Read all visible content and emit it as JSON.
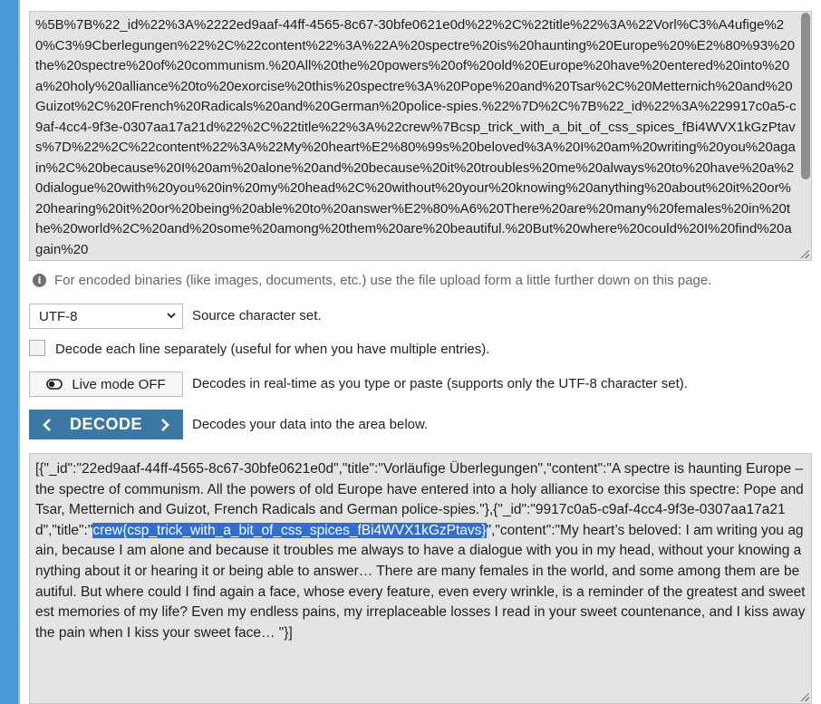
{
  "encoded_input": {
    "value": "%5B%7B%22_id%22%3A%2222ed9aaf-44ff-4565-8c67-30bfe0621e0d%22%2C%22title%22%3A%22Vorl%C3%A4ufige%20%C3%9Cberlegungen%22%2C%22content%22%3A%22A%20spectre%20is%20haunting%20Europe%20%E2%80%93%20the%20spectre%20of%20communism.%20All%20the%20powers%20of%20old%20Europe%20have%20entered%20into%20a%20holy%20alliance%20to%20exorcise%20this%20spectre%3A%20Pope%20and%20Tsar%2C%20Metternich%20and%20Guizot%2C%20French%20Radicals%20and%20German%20police-spies.%22%7D%2C%7B%22_id%22%3A%229917c0a5-c9af-4cc4-9f3e-0307aa17a21d%22%2C%22title%22%3A%22crew%7Bcsp_trick_with_a_bit_of_css_spices_fBi4WVX1kGzPtavs%7D%22%2C%22content%22%3A%22My%20heart%E2%80%99s%20beloved%3A%20I%20am%20writing%20you%20again%2C%20because%20I%20am%20alone%20and%20because%20it%20troubles%20me%20always%20to%20have%20a%20dialogue%20with%20you%20in%20my%20head%2C%20without%20your%20knowing%20anything%20about%20it%20or%20hearing%20it%20or%20being%20able%20to%20answer%E2%80%A6%20There%20are%20many%20females%20in%20the%20world%2C%20and%20some%20among%20them%20are%20beautiful.%20But%20where%20could%20I%20find%20again%20"
  },
  "info_text": "For encoded binaries (like images, documents, etc.) use the file upload form a little further down on this page.",
  "charset": {
    "selected": "UTF-8",
    "label": "Source character set."
  },
  "decode_each_line": {
    "label": "Decode each line separately (useful for when you have multiple entries).",
    "checked": false
  },
  "live_mode": {
    "button_label": "Live mode OFF",
    "description": "Decodes in real-time as you type or paste (supports only the UTF-8 character set)."
  },
  "decode": {
    "button_label": "DECODE",
    "description": "Decodes your data into the area below."
  },
  "output": {
    "before_selection": "[{\"_id\":\"22ed9aaf-44ff-4565-8c67-30bfe0621e0d\",\"title\":\"Vorläufige Überlegungen\",\"content\":\"A spectre is haunting Europe – the spectre of communism. All the powers of old Europe have entered into a holy alliance to exorcise this spectre: Pope and Tsar, Metternich and Guizot, French Radicals and German police-spies.\"},{\"_id\":\"9917c0a5-c9af-4cc4-9f3e-0307aa17a21d\",\"title\":\"",
    "selected_text": "crew{csp_trick_with_a_bit_of_css_spices_fBi4WVX1kGzPtavs}",
    "after_selection": "\",\"content\":\"My heart’s beloved: I am writing you again, because I am alone and because it troubles me always to have a dialogue with you in my head, without your knowing anything about it or hearing it or being able to answer… There are many females in the world, and some among them are beautiful. But where could I find again a face, whose every feature, even every wrinkle, is a reminder of the greatest and sweetest memories of my life? Even my endless pains, my irreplaceable losses I read in your sweet countenance, and I kiss away the pain when I kiss your sweet face… \"}]"
  },
  "icons": {
    "info": "info-icon",
    "select_arrow": "chevron-down-icon",
    "toggle": "toggle-off-icon",
    "left_arrow": "chevron-left-icon",
    "right_arrow": "chevron-right-icon"
  },
  "colors": {
    "decode_button": "#3b79a4",
    "selection": "#2f6fd0",
    "sidebar": "#4a97d6"
  }
}
